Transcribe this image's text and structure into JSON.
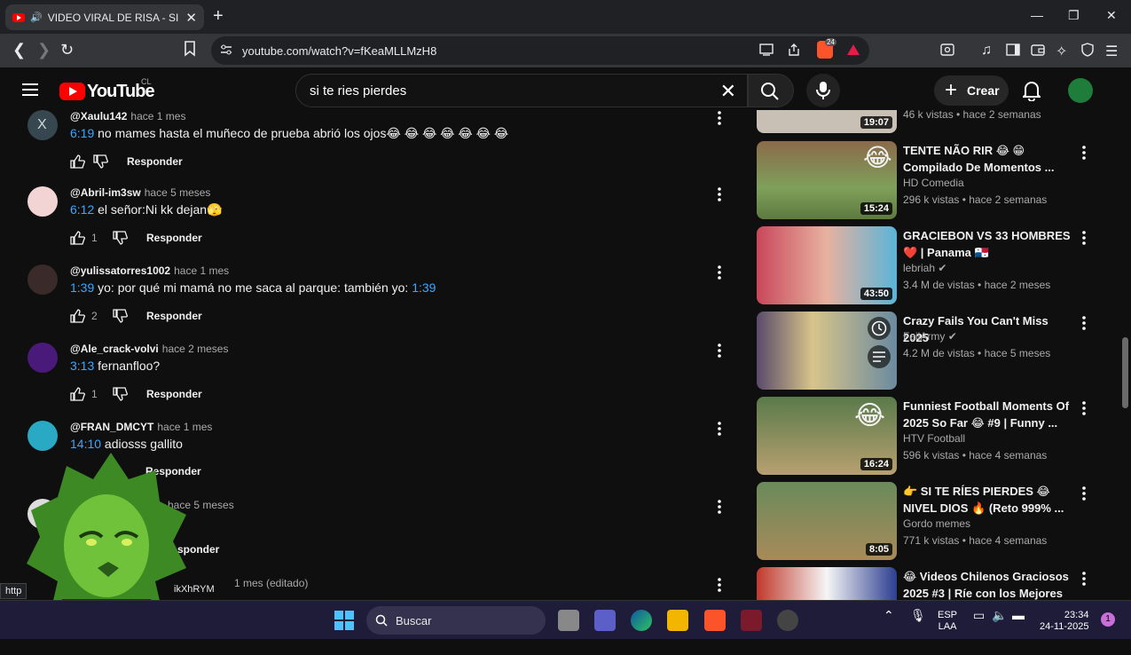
{
  "browser": {
    "tab_title": "VIDEO VIRAL DE RISA - SI TE R",
    "url": "youtube.com/watch?v=fKeaMLLMzH8",
    "badge_count": "24",
    "status_link": "http",
    "status_link2": "ikXhRYM"
  },
  "youtube": {
    "logo_text": "YouTube",
    "country_code": "CL",
    "search_query": "si te ries pierdes",
    "create_label": "Crear"
  },
  "comments": [
    {
      "handle": "@Xaulu142",
      "time": "hace 1 mes",
      "timestamp": "6:19",
      "text": " no mames hasta el muñeco de prueba abrió los ojos😂 😂 😂 😂 😂 😂 😂",
      "likes": "",
      "reply": "Responder"
    },
    {
      "handle": "@Abril-im3sw",
      "time": "hace 5 meses",
      "timestamp": "6:12",
      "text": " el señor:Ni kk dejan🫣",
      "likes": "1",
      "reply": "Responder"
    },
    {
      "handle": "@yulissatorres1002",
      "time": "hace 1 mes",
      "timestamp": "1:39",
      "text": " yo: por qué mi mamá no me saca al parque: también yo: ",
      "timestamp2": "1:39",
      "likes": "2",
      "reply": "Responder"
    },
    {
      "handle": "@Ale_crack-volvi",
      "time": "hace 2 meses",
      "timestamp": "3:13",
      "text": " fernanfloo?",
      "likes": "1",
      "reply": "Responder"
    },
    {
      "handle": "@FRAN_DMCYT",
      "time": "hace 1 mes",
      "timestamp": "14:10",
      "text": " adiosss gallito",
      "likes": "",
      "reply": "Responder"
    },
    {
      "handle": "",
      "time": "hace 5 meses",
      "timestamp": "",
      "text": "",
      "likes": "",
      "reply": "sponder"
    },
    {
      "handle": "",
      "time": "1 mes (editado)",
      "timestamp": "",
      "text": "",
      "likes": "",
      "reply": ""
    }
  ],
  "sidebar": {
    "top_partial": {
      "meta": "46 k vistas • hace 2 semanas",
      "duration": "19:07"
    },
    "videos": [
      {
        "title": "TENTE NÃO RIR 😂 😁 Compilado De Momentos ...",
        "channel": "HD Comedia",
        "verified": false,
        "meta": "296 k vistas • hace 2 semanas",
        "duration": "15:24"
      },
      {
        "title": "GRACIEBON VS 33 HOMBRES ❤️ | Panama 🇵🇦",
        "channel": "lebriah",
        "verified": true,
        "meta": "3.4 M de vistas • hace 2 meses",
        "duration": "43:50"
      },
      {
        "title": "Crazy Fails You Can't Miss 2025",
        "channel": "FailArmy",
        "verified": true,
        "meta": "4.2 M de vistas • hace 5 meses",
        "duration": ""
      },
      {
        "title": "Funniest Football Moments Of 2025 So Far 😂 #9 | Funny ...",
        "channel": "HTV Football",
        "verified": false,
        "meta": "596 k vistas • hace 4 semanas",
        "duration": "16:24"
      },
      {
        "title": "👉 SI TE RÍES PIERDES 😂 NIVEL DIOS 🔥 (Reto 999% ...",
        "channel": "Gordo memes",
        "verified": false,
        "meta": "771 k vistas • hace 4 semanas",
        "duration": "8:05"
      },
      {
        "title": "😂 Videos Chilenos Graciosos 2025 #3 | Ríe con los Mejores ...",
        "channel": "",
        "verified": false,
        "meta": "",
        "duration": ""
      }
    ]
  },
  "taskbar": {
    "search_label": "Buscar",
    "lang_top": "ESP",
    "lang_bottom": "LAA",
    "clock_time": "23:34",
    "clock_date": "24-11-2025",
    "notif_count": "1"
  },
  "colors": {
    "brand_red": "#ff0000",
    "link_blue": "#3ea6ff",
    "bg": "#0f0f0f"
  }
}
